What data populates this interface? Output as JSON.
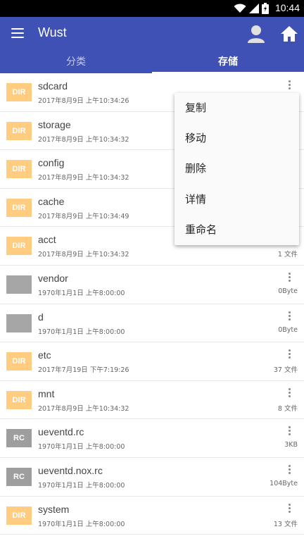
{
  "status_bar": {
    "time": "10:44",
    "icons": [
      "wifi-icon",
      "signal-icon",
      "battery-icon"
    ]
  },
  "app_bar": {
    "title": "Wust",
    "icons": [
      "menu-icon",
      "avatar-icon",
      "home-icon"
    ]
  },
  "tabs": [
    {
      "label": "分类",
      "active": false
    },
    {
      "label": "存储",
      "active": true
    }
  ],
  "files": [
    {
      "badge": "DIR",
      "type": "dir",
      "name": "sdcard",
      "date": "2017年8月9日 上午10:34:26",
      "meta": ""
    },
    {
      "badge": "DIR",
      "type": "dir",
      "name": "storage",
      "date": "2017年8月9日 上午10:34:32",
      "meta": ""
    },
    {
      "badge": "DIR",
      "type": "dir",
      "name": "config",
      "date": "2017年8月9日 上午10:34:32",
      "meta": ""
    },
    {
      "badge": "DIR",
      "type": "dir",
      "name": "cache",
      "date": "2017年8月9日 上午10:34:49",
      "meta": ""
    },
    {
      "badge": "DIR",
      "type": "dir",
      "name": "acct",
      "date": "2017年8月9日 上午10:34:32",
      "meta": "1 文件"
    },
    {
      "badge": "",
      "type": "file",
      "name": "vendor",
      "date": "1970年1月1日 上午8:00:00",
      "meta": "0Byte"
    },
    {
      "badge": "",
      "type": "file",
      "name": "d",
      "date": "1970年1月1日 上午8:00:00",
      "meta": "0Byte"
    },
    {
      "badge": "DIR",
      "type": "dir",
      "name": "etc",
      "date": "2017年7月19日 下午7:19:26",
      "meta": "37 文件"
    },
    {
      "badge": "DIR",
      "type": "dir",
      "name": "mnt",
      "date": "2017年8月9日 上午10:34:32",
      "meta": "8 文件"
    },
    {
      "badge": "RC",
      "type": "rc",
      "name": "ueventd.rc",
      "date": "1970年1月1日 上午8:00:00",
      "meta": "3KB"
    },
    {
      "badge": "RC",
      "type": "rc",
      "name": "ueventd.nox.rc",
      "date": "1970年1月1日 上午8:00:00",
      "meta": "104Byte"
    },
    {
      "badge": "DIR",
      "type": "dir",
      "name": "system",
      "date": "1970年1月1日 上午8:00:00",
      "meta": "13 文件"
    }
  ],
  "context_menu": {
    "items": [
      "复制",
      "移动",
      "删除",
      "详情",
      "重命名"
    ]
  },
  "colors": {
    "primary": "#3f51b5",
    "dir_badge": "#ffcc80",
    "rc_badge": "#9e9e9e",
    "status_bar": "#000000"
  }
}
